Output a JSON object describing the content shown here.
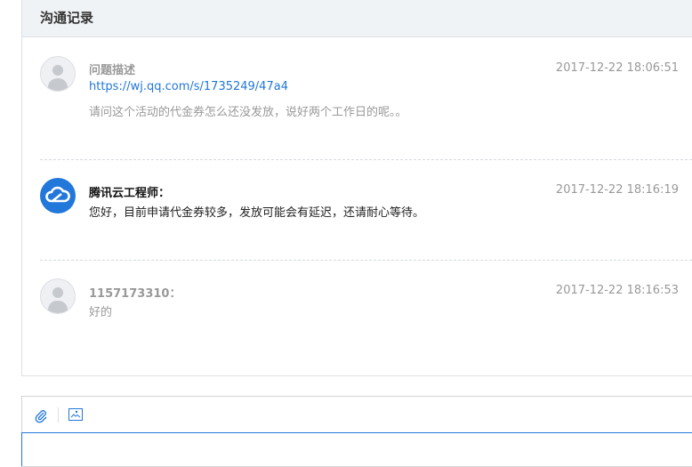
{
  "panel": {
    "title": "沟通记录"
  },
  "messages": [
    {
      "name": "问题描述",
      "time": "2017-12-22 18:06:51",
      "link": "https://wj.qq.com/s/1735249/47a4",
      "text": "请问这个活动的代金券怎么还没发放，说好两个工作日的呢。。",
      "avatar": "user-avatar-icon"
    },
    {
      "name": "腾讯云工程师：",
      "time": "2017-12-22 18:16:19",
      "text": "您好，目前申请代金券较多，发放可能会有延迟，还请耐心等待。",
      "avatar": "tencent-cloud-icon"
    },
    {
      "name": "1157173310：",
      "time": "2017-12-22 18:16:53",
      "text": "好的",
      "avatar": "user-avatar-icon"
    }
  ],
  "colors": {
    "accent": "#2277da"
  }
}
